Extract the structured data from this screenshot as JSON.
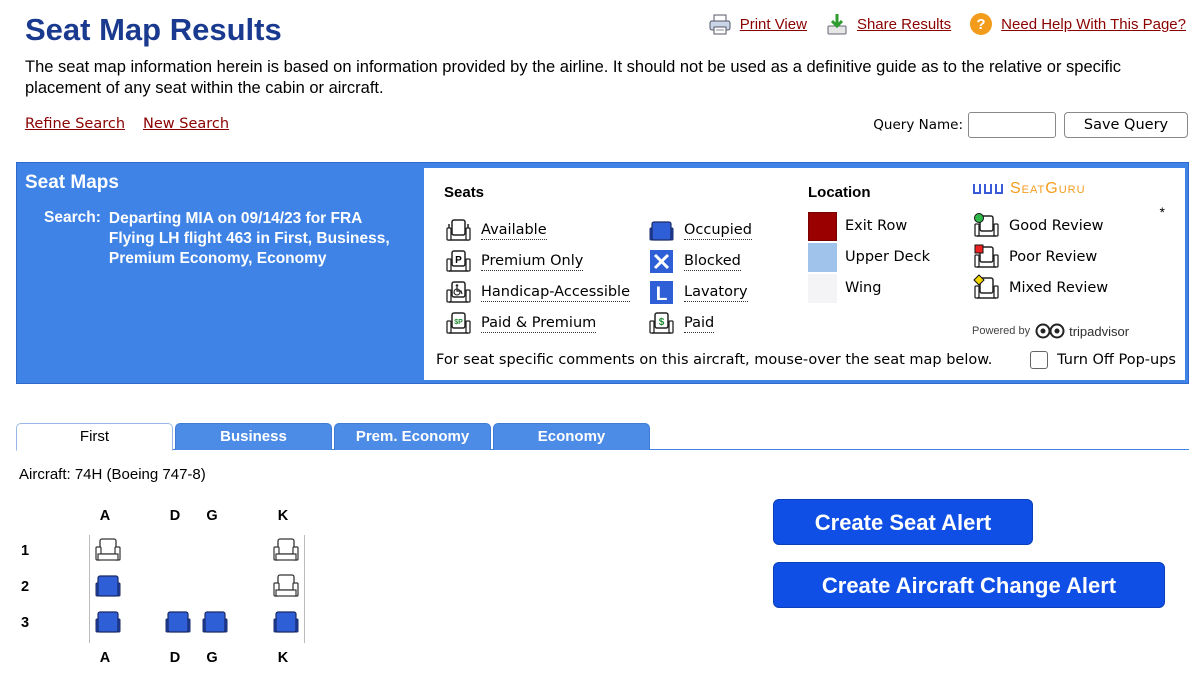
{
  "page": {
    "title": "Seat Map Results",
    "disclaimer": "The seat map information herein is based on information provided by the airline. It should not be used as a definitive guide as to the relative or specific placement of any seat within the cabin or aircraft."
  },
  "top_links": {
    "print": "Print View",
    "share": "Share Results",
    "help": "Need Help With This Page?"
  },
  "search_links": {
    "refine": "Refine Search",
    "new": "New Search"
  },
  "query": {
    "label": "Query Name:",
    "value": "",
    "save": "Save Query"
  },
  "panel": {
    "title": "Seat Maps",
    "search_label": "Search:",
    "search_line1": "Departing MIA on 09/14/23 for FRA",
    "search_line2": "Flying LH flight 463 in First, Business,",
    "search_line3": "Premium Economy, Economy"
  },
  "legend": {
    "seats_heading": "Seats",
    "location_heading": "Location",
    "seatguru": "SeatGuru",
    "asterisk": "*",
    "seats": [
      "Available",
      "Premium Only",
      "Handicap-Accessible",
      "Paid & Premium",
      "Occupied",
      "Blocked",
      "Lavatory",
      "Paid"
    ],
    "locations": [
      "Exit Row",
      "Upper Deck",
      "Wing"
    ],
    "location_colors": [
      "#9b0000",
      "#9fc3ea",
      "#f4f4f6"
    ],
    "reviews": [
      "Good Review",
      "Poor Review",
      "Mixed Review"
    ],
    "powered_by": "Powered by",
    "tripadvisor": "tripadvisor",
    "comment": "For seat specific comments on this aircraft, mouse-over the seat map below.",
    "popups": "Turn Off Pop-ups"
  },
  "tabs": [
    "First",
    "Business",
    "Prem. Economy",
    "Economy"
  ],
  "aircraft": "Aircraft: 74H (Boeing 747-8)",
  "seatmap": {
    "columns": [
      "A",
      "D",
      "G",
      "K"
    ],
    "rows": [
      "1",
      "2",
      "3"
    ],
    "seats": {
      "1A": "available",
      "1K": "available",
      "2A": "occupied",
      "2K": "available",
      "3A": "occupied",
      "3D": "occupied",
      "3G": "occupied",
      "3K": "occupied"
    }
  },
  "alerts": {
    "seat_alert": "Create Seat Alert",
    "aircraft_alert": "Create Aircraft Change Alert"
  },
  "colors": {
    "title": "#1a3a8f",
    "link": "#8b0000",
    "panel": "#3f83e6",
    "occupied_seat": "#2e5fd6",
    "alert_button": "#0f4fe6"
  }
}
